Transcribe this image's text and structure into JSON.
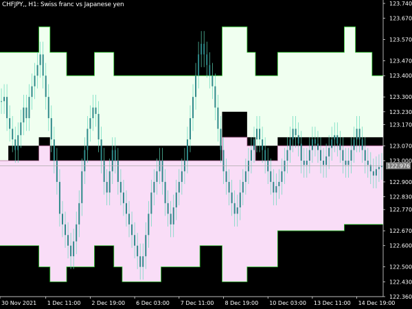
{
  "window": {
    "symbol_title": "CHFJPY,, H1:  Swiss franc vs Japanese yen"
  },
  "colors": {
    "background": "#000000",
    "upper_band_fill": "#f0fff0",
    "upper_band_edge": "#2ec82e",
    "lower_band_fill": "#f9ddf7",
    "baseline_line": "#b06a96",
    "candles": "#2e8a8a",
    "wicks": "#5fd8b8",
    "current_price_line": "#a9a9a9",
    "current_price_badge": "#7f7f7f",
    "axis_text": "#ffffff"
  },
  "chart_data": {
    "type": "line",
    "title": "",
    "xlabel": "",
    "ylabel": "",
    "ylim": [
      122.36,
      123.74
    ],
    "grid": false,
    "legend": "none",
    "current_price": 122.976,
    "current_price_label": "122.976",
    "y_ticks": [
      {
        "value": 123.74,
        "label": "123.740"
      },
      {
        "value": 123.67,
        "label": "123.670"
      },
      {
        "value": 123.57,
        "label": "123.570"
      },
      {
        "value": 123.47,
        "label": "123.470"
      },
      {
        "value": 123.4,
        "label": "123.400"
      },
      {
        "value": 123.3,
        "label": "123.300"
      },
      {
        "value": 123.23,
        "label": "123.230"
      },
      {
        "value": 123.17,
        "label": "123.170"
      },
      {
        "value": 123.07,
        "label": "123.070"
      },
      {
        "value": 123.0,
        "label": "123.000"
      },
      {
        "value": 122.9,
        "label": "122.900"
      },
      {
        "value": 122.83,
        "label": "122.830"
      },
      {
        "value": 122.77,
        "label": "122.770"
      },
      {
        "value": 122.67,
        "label": "122.670"
      },
      {
        "value": 122.6,
        "label": "122.600"
      },
      {
        "value": 122.5,
        "label": "122.500"
      },
      {
        "value": 122.43,
        "label": "122.430"
      },
      {
        "value": 122.36,
        "label": "122.360"
      }
    ],
    "x_ticks": [
      {
        "index": 0,
        "label": "30 Nov 2021"
      },
      {
        "index": 16,
        "label": "1 Dec 11:00"
      },
      {
        "index": 32,
        "label": "2 Dec 19:00"
      },
      {
        "index": 48,
        "label": "6 Dec 03:00"
      },
      {
        "index": 64,
        "label": "7 Dec 11:00"
      },
      {
        "index": 80,
        "label": "8 Dec 19:00"
      },
      {
        "index": 96,
        "label": "10 Dec 03:00"
      },
      {
        "index": 112,
        "label": "13 Dec 11:00"
      },
      {
        "index": 128,
        "label": "14 Dec 19:00"
      }
    ],
    "bar_count": 138,
    "series": [
      {
        "type": "step_band",
        "upper_top": [
          123.51,
          123.51,
          123.51,
          123.51,
          123.51,
          123.51,
          123.51,
          123.51,
          123.51,
          123.51,
          123.51,
          123.51,
          123.51,
          123.51,
          123.63,
          123.63,
          123.63,
          123.63,
          123.51,
          123.51,
          123.51,
          123.51,
          123.51,
          123.51,
          123.4,
          123.4,
          123.4,
          123.4,
          123.4,
          123.4,
          123.4,
          123.4,
          123.4,
          123.4,
          123.51,
          123.51,
          123.51,
          123.51,
          123.51,
          123.51,
          123.51,
          123.4,
          123.4,
          123.4,
          123.4,
          123.4,
          123.4,
          123.4,
          123.4,
          123.4,
          123.4,
          123.4,
          123.4,
          123.4,
          123.4,
          123.4,
          123.4,
          123.4,
          123.4,
          123.4,
          123.4,
          123.4,
          123.4,
          123.4,
          123.4,
          123.4,
          123.4,
          123.4,
          123.4,
          123.4,
          123.4,
          123.4,
          123.4,
          123.4,
          123.4,
          123.4,
          123.4,
          123.4,
          123.4,
          123.4,
          123.63,
          123.63,
          123.63,
          123.63,
          123.63,
          123.63,
          123.63,
          123.63,
          123.63,
          123.51,
          123.51,
          123.51,
          123.4,
          123.4,
          123.4,
          123.4,
          123.4,
          123.4,
          123.4,
          123.4,
          123.51,
          123.51,
          123.51,
          123.51,
          123.51,
          123.51,
          123.51,
          123.51,
          123.51,
          123.51,
          123.51,
          123.51,
          123.51,
          123.51,
          123.51,
          123.51,
          123.51,
          123.51,
          123.51,
          123.51,
          123.51,
          123.51,
          123.51,
          123.51,
          123.63,
          123.63,
          123.63,
          123.63,
          123.51,
          123.51,
          123.51,
          123.51,
          123.51,
          123.51,
          123.4,
          123.4,
          123.4,
          123.4
        ],
        "upper_bottom": [
          123.0,
          123.0,
          123.0,
          123.07,
          123.07,
          123.07,
          123.07,
          123.07,
          123.07,
          123.07,
          123.07,
          123.07,
          123.07,
          123.07,
          123.11,
          123.11,
          123.11,
          123.11,
          123.07,
          123.07,
          123.07,
          123.07,
          123.07,
          123.07,
          123.07,
          123.07,
          123.07,
          123.07,
          123.07,
          123.07,
          123.07,
          123.07,
          123.07,
          123.07,
          123.07,
          123.07,
          123.07,
          123.07,
          123.07,
          123.07,
          123.07,
          123.07,
          123.07,
          123.07,
          123.07,
          123.07,
          123.07,
          123.07,
          123.07,
          123.07,
          123.07,
          123.07,
          123.07,
          123.07,
          123.07,
          123.07,
          123.07,
          123.07,
          123.07,
          123.07,
          123.07,
          123.07,
          123.07,
          123.07,
          123.07,
          123.07,
          123.07,
          123.07,
          123.07,
          123.07,
          123.07,
          123.07,
          123.07,
          123.07,
          123.07,
          123.07,
          123.07,
          123.07,
          123.07,
          123.07,
          123.23,
          123.23,
          123.23,
          123.23,
          123.23,
          123.23,
          123.23,
          123.23,
          123.23,
          123.11,
          123.11,
          123.11,
          123.07,
          123.07,
          123.07,
          123.07,
          123.07,
          123.07,
          123.07,
          123.07,
          123.11,
          123.11,
          123.11,
          123.11,
          123.11,
          123.11,
          123.11,
          123.11,
          123.11,
          123.11,
          123.11,
          123.11,
          123.11,
          123.11,
          123.11,
          123.11,
          123.11,
          123.11,
          123.11,
          123.11,
          123.11,
          123.11,
          123.11,
          123.11,
          123.11,
          123.11,
          123.11,
          123.11,
          123.11,
          123.11,
          123.11,
          123.11,
          123.11,
          123.11,
          123.11,
          123.11,
          123.11,
          123.11
        ]
      },
      {
        "type": "step_band",
        "lower_top": [
          123.0,
          123.0,
          123.0,
          123.0,
          123.0,
          123.0,
          123.0,
          123.0,
          123.0,
          123.0,
          123.0,
          123.0,
          123.0,
          123.0,
          123.07,
          123.07,
          123.07,
          123.07,
          123.0,
          123.0,
          123.0,
          123.0,
          123.0,
          123.0,
          123.0,
          123.0,
          123.0,
          123.0,
          123.0,
          123.0,
          123.0,
          123.0,
          123.0,
          123.0,
          123.0,
          123.0,
          123.0,
          123.0,
          123.0,
          123.0,
          123.0,
          123.0,
          123.0,
          123.0,
          123.0,
          123.0,
          123.0,
          123.0,
          123.0,
          123.0,
          123.0,
          123.0,
          123.0,
          123.0,
          123.0,
          123.0,
          123.0,
          123.0,
          123.0,
          123.0,
          123.0,
          123.0,
          123.0,
          123.0,
          123.0,
          123.0,
          123.0,
          123.0,
          123.0,
          123.0,
          123.0,
          123.0,
          123.0,
          123.0,
          123.0,
          123.0,
          123.0,
          123.0,
          123.0,
          123.0,
          123.11,
          123.11,
          123.11,
          123.11,
          123.11,
          123.11,
          123.11,
          123.11,
          123.11,
          123.07,
          123.07,
          123.07,
          123.0,
          123.0,
          123.0,
          123.0,
          123.0,
          123.0,
          123.0,
          123.0,
          123.07,
          123.07,
          123.07,
          123.07,
          123.07,
          123.07,
          123.07,
          123.07,
          123.07,
          123.07,
          123.07,
          123.07,
          123.07,
          123.07,
          123.07,
          123.07,
          123.07,
          123.07,
          123.07,
          123.07,
          123.07,
          123.07,
          123.07,
          123.07,
          123.07,
          123.07,
          123.07,
          123.07,
          123.07,
          123.07,
          123.07,
          123.07,
          123.07,
          123.07,
          123.07,
          123.07,
          123.07,
          123.07
        ],
        "lower_bottom": [
          122.6,
          122.6,
          122.6,
          122.6,
          122.6,
          122.6,
          122.6,
          122.6,
          122.6,
          122.6,
          122.6,
          122.6,
          122.6,
          122.6,
          122.5,
          122.5,
          122.5,
          122.5,
          122.43,
          122.43,
          122.43,
          122.43,
          122.43,
          122.43,
          122.5,
          122.5,
          122.5,
          122.5,
          122.5,
          122.5,
          122.5,
          122.5,
          122.5,
          122.5,
          122.6,
          122.6,
          122.6,
          122.6,
          122.6,
          122.6,
          122.6,
          122.5,
          122.5,
          122.5,
          122.43,
          122.43,
          122.43,
          122.43,
          122.43,
          122.43,
          122.43,
          122.43,
          122.43,
          122.43,
          122.43,
          122.43,
          122.43,
          122.43,
          122.5,
          122.5,
          122.5,
          122.5,
          122.5,
          122.5,
          122.5,
          122.5,
          122.5,
          122.5,
          122.5,
          122.5,
          122.5,
          122.5,
          122.6,
          122.6,
          122.6,
          122.6,
          122.6,
          122.6,
          122.6,
          122.6,
          122.43,
          122.43,
          122.43,
          122.43,
          122.43,
          122.43,
          122.43,
          122.43,
          122.43,
          122.5,
          122.5,
          122.5,
          122.5,
          122.5,
          122.5,
          122.5,
          122.5,
          122.5,
          122.5,
          122.5,
          122.67,
          122.67,
          122.67,
          122.67,
          122.67,
          122.67,
          122.67,
          122.67,
          122.67,
          122.67,
          122.67,
          122.67,
          122.67,
          122.67,
          122.67,
          122.67,
          122.67,
          122.67,
          122.67,
          122.67,
          122.67,
          122.67,
          122.67,
          122.67,
          122.7,
          122.7,
          122.7,
          122.7,
          122.7,
          122.7,
          122.7,
          122.7,
          122.7,
          122.7,
          122.7,
          122.7,
          122.7,
          122.7
        ]
      },
      {
        "name": "",
        "type": "candles",
        "close": [
          123.28,
          123.3,
          123.2,
          123.15,
          123.1,
          123.05,
          123.12,
          123.18,
          123.25,
          123.2,
          123.3,
          123.35,
          123.4,
          123.45,
          123.5,
          123.4,
          123.3,
          123.2,
          123.1,
          123.0,
          122.9,
          122.75,
          122.7,
          122.65,
          122.6,
          122.55,
          122.62,
          122.7,
          122.8,
          122.95,
          123.05,
          123.15,
          123.2,
          123.25,
          123.22,
          123.1,
          123.0,
          122.9,
          122.85,
          122.95,
          123.05,
          123.0,
          122.9,
          122.85,
          122.8,
          122.75,
          122.7,
          122.65,
          122.6,
          122.55,
          122.5,
          122.55,
          122.65,
          122.75,
          122.85,
          122.9,
          122.95,
          123.0,
          122.9,
          122.8,
          122.75,
          122.7,
          122.78,
          122.85,
          122.9,
          122.95,
          123.0,
          123.1,
          123.2,
          123.3,
          123.4,
          123.5,
          123.55,
          123.5,
          123.45,
          123.4,
          123.35,
          123.25,
          123.15,
          123.05,
          122.95,
          122.9,
          122.85,
          122.8,
          122.75,
          122.78,
          122.85,
          122.9,
          122.95,
          123.0,
          123.05,
          123.1,
          123.15,
          123.1,
          123.05,
          123.0,
          122.95,
          122.9,
          122.85,
          122.88,
          122.9,
          122.95,
          123.0,
          123.05,
          123.1,
          123.15,
          123.12,
          123.08,
          123.0,
          122.98,
          123.0,
          123.05,
          123.1,
          123.08,
          123.05,
          123.0,
          122.98,
          123.02,
          123.06,
          123.1,
          123.12,
          123.08,
          123.05,
          123.0,
          122.98,
          123.0,
          123.05,
          123.1,
          123.15,
          123.1,
          123.05,
          123.0,
          122.98,
          122.95,
          122.93,
          122.96,
          122.97,
          122.976
        ]
      }
    ]
  }
}
